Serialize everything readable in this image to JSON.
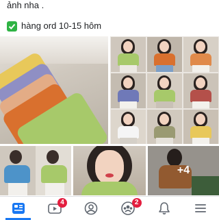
{
  "post": {
    "line1": "ảnh nha .",
    "line2": "hàng ord 10-15 hôm"
  },
  "media": {
    "more_count": "+4"
  },
  "navbar": {
    "items": [
      {
        "name": "home",
        "badge": ""
      },
      {
        "name": "watch",
        "badge": "4"
      },
      {
        "name": "profile",
        "badge": ""
      },
      {
        "name": "groups",
        "badge": "2"
      },
      {
        "name": "notifications",
        "badge": ""
      },
      {
        "name": "menu",
        "badge": ""
      }
    ],
    "accent": "#1877f2",
    "badge_color": "#e41e3f"
  }
}
